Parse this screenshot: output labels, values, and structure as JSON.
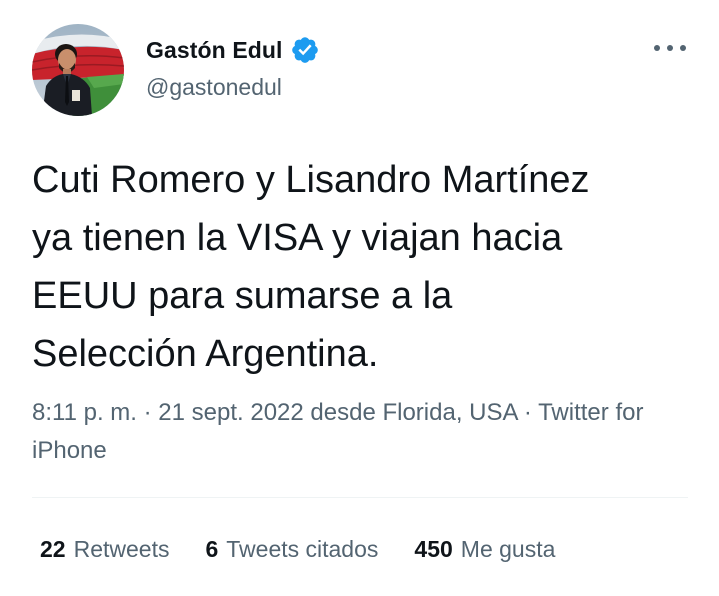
{
  "author": {
    "display_name": "Gastón Edul",
    "handle": "@gastonedul",
    "verified_icon": "verified-badge-icon",
    "verified_color": "#1d9bf0"
  },
  "tweet": {
    "text": "Cuti Romero y Lisandro Martínez\nya tienen la VISA y viajan hacia\nEEUU para sumarse a la\nSelección Argentina.",
    "time": "8:11 p. m.",
    "separator_1": " · ",
    "date": "21 sept. 2022",
    "location_prefix": " desde ",
    "location": "Florida, USA",
    "separator_2": " · ",
    "source": "Twitter for iPhone"
  },
  "stats": [
    {
      "count": "22",
      "label": "Retweets"
    },
    {
      "count": "6",
      "label": "Tweets citados"
    },
    {
      "count": "450",
      "label": "Me gusta"
    }
  ],
  "more_icon": "more-options-icon",
  "colors": {
    "text_primary": "#0f1419",
    "text_secondary": "#536471",
    "divider": "#eff3f4"
  }
}
